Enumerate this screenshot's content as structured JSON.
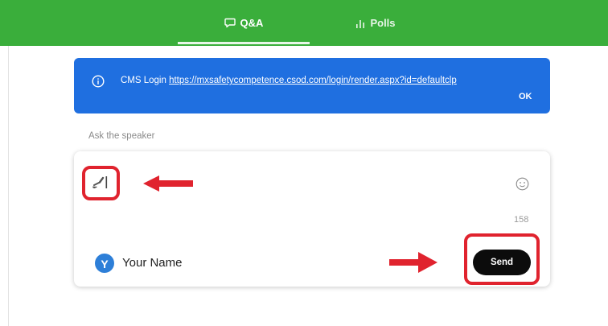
{
  "tabs": [
    {
      "label": "Q&A",
      "icon": "chat-bubble-icon",
      "active": true
    },
    {
      "label": "Polls",
      "icon": "bar-chart-icon",
      "active": false
    }
  ],
  "banner": {
    "prefix": "CMS Login ",
    "link_text": "https://mxsafetycompetence.csod.com/login/render.aspx?id=defaultclp",
    "ok_label": "OK",
    "icon": "info-icon"
  },
  "ask": {
    "label": "Ask the speaker",
    "char_count": "158",
    "user_initial": "Y",
    "user_name": "Your Name",
    "send_label": "Send"
  },
  "colors": {
    "topbar": "#3aae3b",
    "banner": "#1f6fe0",
    "highlight": "#e0232e",
    "send_button": "#0c0c0c",
    "avatar": "#2d7fd8"
  }
}
